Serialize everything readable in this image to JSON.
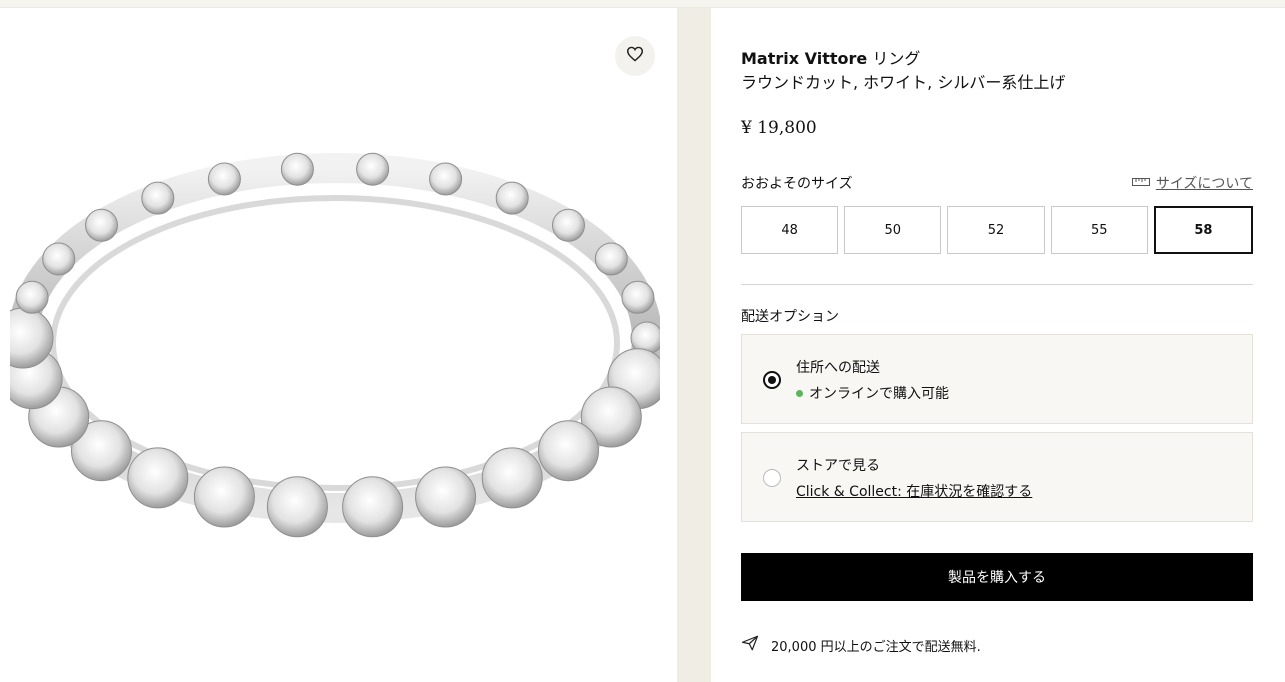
{
  "product": {
    "brand": "Matrix Vittore",
    "type": "リング",
    "subtitle": "ラウンドカット, ホワイト, シルバー系仕上げ",
    "price": "¥ 19,800"
  },
  "size": {
    "label": "おおよそのサイズ",
    "guide_label": "サイズについて",
    "options": [
      "48",
      "50",
      "52",
      "55",
      "58"
    ],
    "selected": "58"
  },
  "shipping": {
    "label": "配送オプション",
    "options": [
      {
        "title": "住所への配送",
        "sub": "オンラインで購入可能",
        "selected": true
      },
      {
        "title": "ストアで見る",
        "sub": "Click & Collect: 在庫状況を確認する",
        "selected": false
      }
    ]
  },
  "buy_label": "製品を購入する",
  "free_shipping_note": "20,000 円以上のご注文で配送無料.",
  "icons": {
    "wishlist": "heart-icon",
    "size_guide": "ruler-icon",
    "shipping": "paper-plane-icon"
  },
  "colors": {
    "accent": "#000000",
    "available": "#5bb55b",
    "panel_bg": "#f0ede5"
  }
}
